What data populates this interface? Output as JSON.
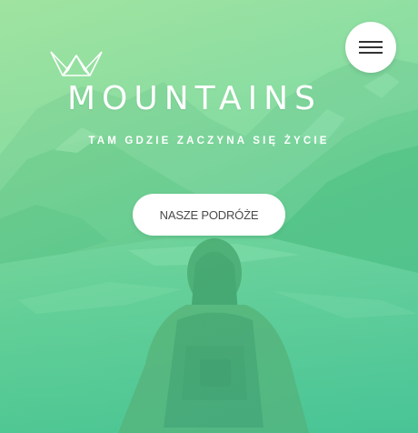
{
  "hero": {
    "brand_title": "MOUNTAINS",
    "tagline": "TAM GDZIE ZACZYNA SIĘ ŻYCIE",
    "cta_label": "NASZE PODRÓŻE",
    "logo_icon": "crown-mountain-icon",
    "menu_icon": "hamburger-menu-icon"
  },
  "colors": {
    "overlay_start": "#8cdc82",
    "overlay_end": "#3cc396",
    "text": "#ffffff",
    "button_bg": "#ffffff",
    "button_text": "#4a4a4a"
  }
}
